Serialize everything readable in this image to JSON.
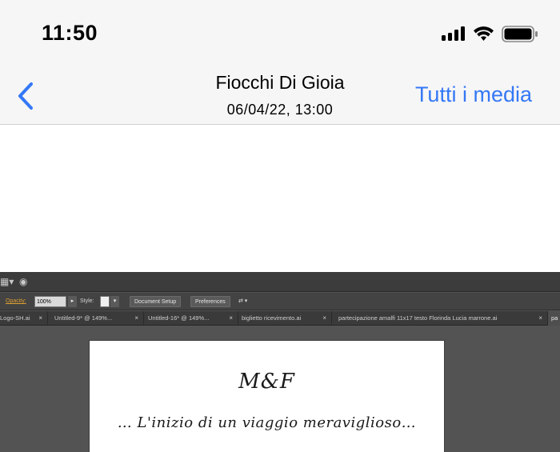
{
  "status_bar": {
    "time": "11:50",
    "icons": [
      "cellular-signal-icon",
      "wifi-icon",
      "battery-icon"
    ]
  },
  "nav": {
    "back_icon": "chevron-left-icon",
    "title": "Fiocchi Di Gioia",
    "subtitle": "06/04/22, 13:00",
    "all_media_label": "Tutti i media"
  },
  "colors": {
    "ios_blue": "#3478f6",
    "bar_bg": "#f6f6f6",
    "app_dark": "#535353",
    "opacity_label": "#e0a030"
  },
  "editor": {
    "toolbar_icons": [
      "arrange-icon",
      "visibility-icon"
    ],
    "control_bar": {
      "opacity_label": "Opacity:",
      "opacity_value": "100%",
      "style_label": "Style:",
      "document_setup": "Document Setup",
      "preferences": "Preferences"
    },
    "tabs": [
      {
        "label": "Logo-SH.ai",
        "close": "×"
      },
      {
        "label": "Untitled-9* @ 149%...",
        "close": "×"
      },
      {
        "label": "Untitled-16* @ 149%...",
        "close": "×"
      },
      {
        "label": "biglietto ricevimento.ai",
        "close": "×"
      },
      {
        "label": "partecipazione amalfi 11x17 testo Florinda Lucia marrone.ai",
        "close": "×"
      },
      {
        "label": "pa",
        "close": ""
      }
    ],
    "artboard": {
      "monogram": "M&F",
      "tagline": "… L'inizio di un viaggio meraviglioso…"
    }
  }
}
